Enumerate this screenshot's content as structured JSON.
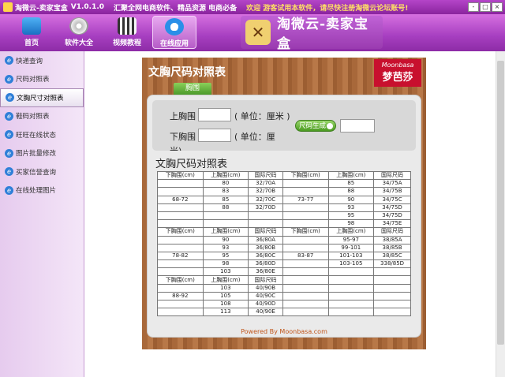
{
  "titlebar": {
    "app_name": "淘微云-卖家宝盒",
    "version": "V1.0.1.0",
    "slogan": "汇聚全网电商软件、精品资源  电商必备",
    "welcome": "欢迎 游客试用本软件，请尽快注册淘微云论坛账号!",
    "min": "-",
    "max": "□",
    "close": "×"
  },
  "toolbar": {
    "buttons": [
      {
        "label": "首页",
        "icon": "home-monitor-icon"
      },
      {
        "label": "软件大全",
        "icon": "software-cd-icon"
      },
      {
        "label": "视频教程",
        "icon": "video-film-icon"
      },
      {
        "label": "在线应用",
        "icon": "ie-browser-icon",
        "active": true
      }
    ],
    "brand_text": "淘微云-卖家宝盒",
    "brand_icon": "tools-icon"
  },
  "sidebar": {
    "items": [
      {
        "label": "快递查询"
      },
      {
        "label": "尺码对照表"
      },
      {
        "label": "文胸尺寸对照表",
        "active": true
      },
      {
        "label": "鞋码对照表"
      },
      {
        "label": "旺旺在线状态"
      },
      {
        "label": "图片批量修改"
      },
      {
        "label": "买家信誉查询"
      },
      {
        "label": "在线处理图片"
      }
    ]
  },
  "panel": {
    "title": "文胸尺码对照表",
    "logo_top": "Moonbasa",
    "logo_bottom": "梦芭莎",
    "tab": "胸围",
    "form": {
      "upper_label": "上胸围",
      "upper_unit": "( 单位：厘米 )",
      "upper_value": "",
      "lower_label": "下胸围",
      "lower_unit": "( 单位：厘",
      "lower_value": "",
      "overflow_text": "米)",
      "calc_button": "尺码生成",
      "result_value": ""
    },
    "chart_title": "文胸尺码对照表",
    "powered": "Powered By Moonbasa.com"
  },
  "table": {
    "header": [
      "下胸围(cm)",
      "上胸围(cm)",
      "国际尺码"
    ],
    "rows": [
      [
        "",
        "",
        "",
        "",
        "",
        ""
      ],
      [
        "",
        "80",
        "32/70A",
        "",
        "85",
        "34/75A"
      ],
      [
        "",
        "83",
        "32/70B",
        "",
        "88",
        "34/75B"
      ],
      [
        "68-72",
        "85",
        "32/70C",
        "73-77",
        "90",
        "34/75C"
      ],
      [
        "",
        "88",
        "32/70D",
        "",
        "93",
        "34/75D"
      ],
      [
        "",
        "",
        "",
        "",
        "95",
        "34/75D"
      ],
      [
        "",
        "",
        "",
        "",
        "98",
        "34/75E"
      ],
      [
        "",
        "",
        "",
        "",
        "",
        ""
      ],
      [
        "",
        "90",
        "36/80A",
        "",
        "95-97",
        "38/85A"
      ],
      [
        "",
        "93",
        "36/80B",
        "",
        "99-101",
        "38/85B"
      ],
      [
        "78-82",
        "95",
        "36/80C",
        "83-87",
        "101-103",
        "38/85C"
      ],
      [
        "",
        "98",
        "36/80D",
        "",
        "103-105",
        "338/85D"
      ],
      [
        "",
        "103",
        "36/80E",
        "",
        "",
        ""
      ],
      [
        "",
        "",
        "",
        "",
        "",
        ""
      ],
      [
        "",
        "103",
        "40/90B",
        "",
        "",
        ""
      ],
      [
        "88-92",
        "105",
        "40/90C",
        "",
        "",
        ""
      ],
      [
        "",
        "108",
        "40/90D",
        "",
        "",
        ""
      ],
      [
        "",
        "113",
        "40/90E",
        "",
        "",
        ""
      ]
    ]
  }
}
